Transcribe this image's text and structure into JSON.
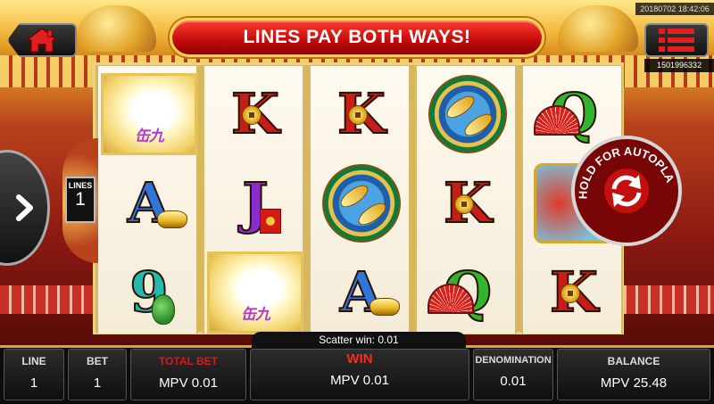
{
  "header": {
    "timestamp": "20180702 18:42:06",
    "account_id": "1501996332",
    "banner": "LINES PAY BOTH WAYS!",
    "home_icon": "home-icon",
    "menu_icon": "menu-icon"
  },
  "reels": [
    [
      "scatter",
      "A",
      "9"
    ],
    [
      "K",
      "J",
      "scatter"
    ],
    [
      "K",
      "koi",
      "A"
    ],
    [
      "koi",
      "K",
      "Q"
    ],
    [
      "Q",
      "dragon",
      "K"
    ]
  ],
  "scatter_text": "缶九",
  "lines_indicator": {
    "label": "LINES",
    "value": "1"
  },
  "autoplay": {
    "label": "HOLD FOR AUTOPLAY"
  },
  "scatter_win": "Scatter win: 0.01",
  "panel": {
    "line": {
      "label": "LINE",
      "value": "1"
    },
    "bet": {
      "label": "BET",
      "value": "1"
    },
    "total_bet": {
      "label": "TOTAL BET",
      "value": "MPV 0.01"
    },
    "win": {
      "label": "WIN",
      "value": "MPV 0.01"
    },
    "denomination": {
      "label": "DENOMINATION",
      "value": "0.01"
    },
    "balance": {
      "label": "BALANCE",
      "value": "MPV 25.48"
    }
  },
  "colors": {
    "banner_red": "#c30b0b",
    "gold": "#d6a72e",
    "total_bet_red": "#d71a1a",
    "win_red": "#ff2a1a"
  }
}
